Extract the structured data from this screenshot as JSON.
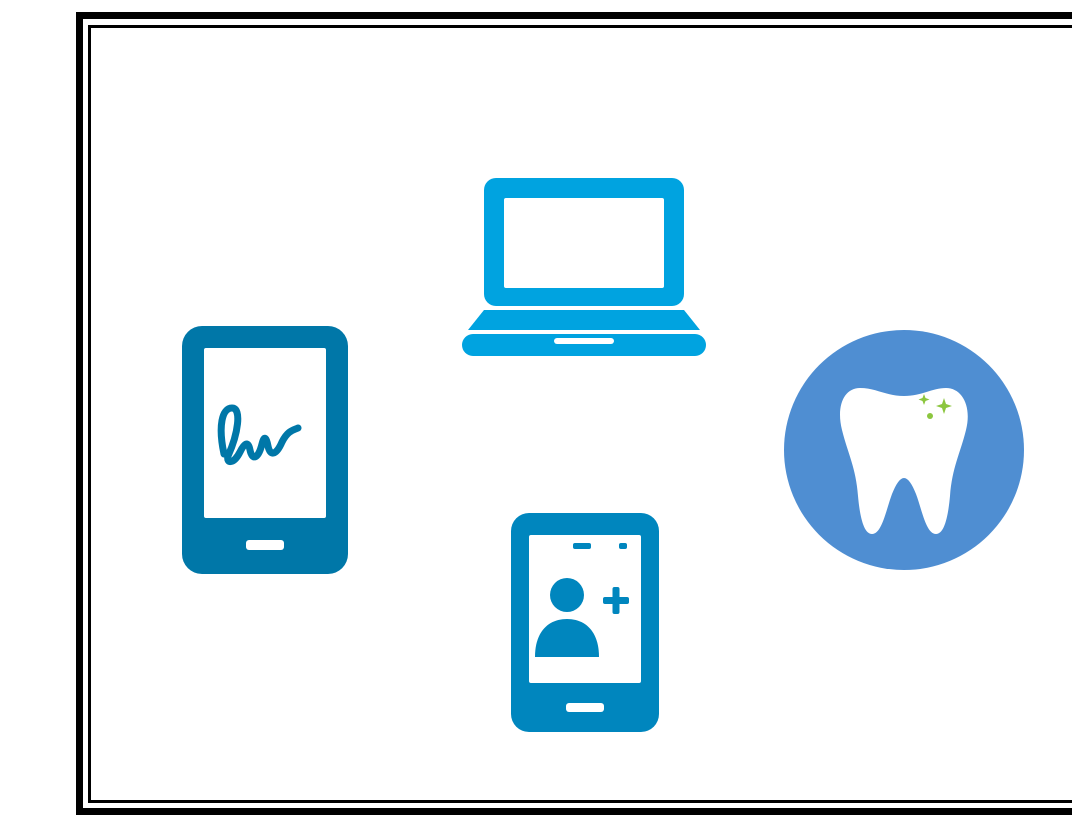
{
  "icons": [
    {
      "name": "laptop-icon",
      "color": "#00a3e0"
    },
    {
      "name": "signature-phone-icon",
      "color": "#0077a8"
    },
    {
      "name": "add-contact-phone-icon",
      "color": "#0086be"
    },
    {
      "name": "dental-tooth-icon",
      "color": "#4f8ed2",
      "accent": "#8cc63f"
    }
  ],
  "colors": {
    "frame": "#000000",
    "background": "#ffffff"
  }
}
